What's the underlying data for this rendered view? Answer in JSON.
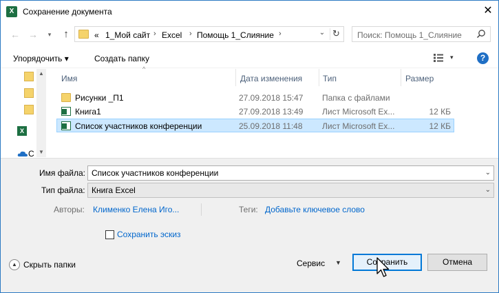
{
  "window": {
    "title": "Сохранение документа",
    "close_glyph": "✕",
    "app_icon_letter": "X"
  },
  "nav": {
    "back_glyph": "←",
    "forward_glyph": "→",
    "recent_glyph": "▾",
    "up_glyph": "↑",
    "breadcrumb": [
      "«",
      "1_Мой сайт",
      "Excel",
      "Помощь 1_Слияние"
    ],
    "separators": [
      "›",
      "›",
      "›"
    ],
    "dropdown_glyph": "⌄",
    "refresh_glyph": "↻",
    "search_placeholder": "Поиск: Помощь 1_Слияние"
  },
  "toolbar": {
    "organize_label": "Упорядочить ▾",
    "new_folder_label": "Создать папку",
    "view_arrow": "▾",
    "help_label": "?"
  },
  "navpane": {
    "scroll_up": "▲",
    "scroll_down": "▼",
    "items": [
      {
        "icon": "folder-icon",
        "text": ""
      },
      {
        "icon": "folder-icon",
        "text": ""
      },
      {
        "icon": "folder-icon",
        "text": ""
      },
      {
        "icon": "excel-icon",
        "text": ""
      },
      {
        "icon": "onedrive-icon",
        "text": "C"
      }
    ]
  },
  "filelist": {
    "sort_arrow": "^",
    "columns": [
      "Имя",
      "Дата изменения",
      "Тип",
      "Размер"
    ],
    "rows": [
      {
        "icon": "folder-icon",
        "name": "Рисунки _П1",
        "date": "27.09.2018 15:47",
        "type": "Папка с файлами",
        "size": "",
        "selected": false
      },
      {
        "icon": "excel-file-icon",
        "name": "Книга1",
        "date": "27.09.2018 13:49",
        "type": "Лист Microsoft Ex...",
        "size": "12 КБ",
        "selected": false
      },
      {
        "icon": "excel-file-icon",
        "name": "Список участников конференции",
        "date": "25.09.2018 11:48",
        "type": "Лист Microsoft Ex...",
        "size": "12 КБ",
        "selected": true
      }
    ]
  },
  "form": {
    "filename_label": "Имя файла:",
    "filename_value": "Список участников конференции",
    "filetype_label": "Тип файла:",
    "filetype_value": "Книга Excel",
    "dropdown_glyph": "⌄",
    "authors_label": "Авторы:",
    "authors_value": "Клименко Елена Иго...",
    "tags_label": "Теги:",
    "tags_value": "Добавьте ключевое слово",
    "thumbnail_label": "Сохранить эскиз",
    "thumbnail_checked": false
  },
  "footer": {
    "hide_folders_glyph": "▲",
    "hide_folders_label": "Скрыть папки",
    "tools_label": "Сервис",
    "tools_arrow": "▼",
    "save_label": "Сохранить",
    "cancel_label": "Отмена"
  },
  "colors": {
    "accent": "#0078d7",
    "link": "#0066cc",
    "selection": "#cce8ff",
    "excel_green": "#1d6f42",
    "folder": "#f5d36b"
  }
}
